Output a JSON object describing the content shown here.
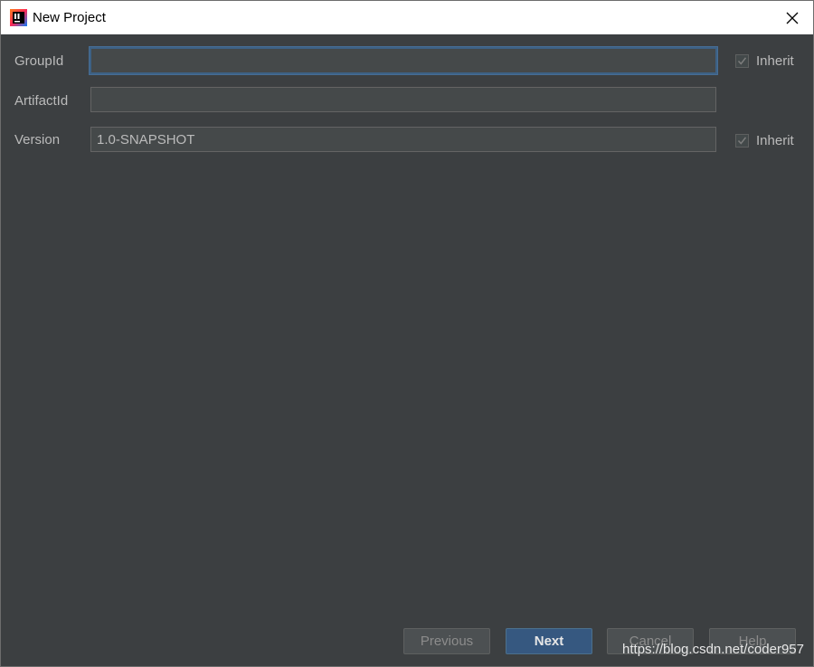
{
  "window": {
    "title": "New Project"
  },
  "form": {
    "group_id": {
      "label": "GroupId",
      "value": "",
      "inherit_label": "Inherit",
      "inherit_checked": true
    },
    "artifact_id": {
      "label": "ArtifactId",
      "value": ""
    },
    "version": {
      "label": "Version",
      "value": "1.0-SNAPSHOT",
      "inherit_label": "Inherit",
      "inherit_checked": true
    }
  },
  "buttons": {
    "previous": "Previous",
    "next": "Next",
    "cancel": "Cancel",
    "help": "Help"
  },
  "watermark": "https://blog.csdn.net/coder957",
  "colors": {
    "background": "#3c3f41",
    "field_background": "#45494a",
    "text": "#bbbbbb",
    "focus_border": "#3d6185",
    "primary_button": "#365880"
  },
  "icons": {
    "app": "intellij-idea-icon",
    "close": "close-icon",
    "check": "checkmark-icon"
  }
}
